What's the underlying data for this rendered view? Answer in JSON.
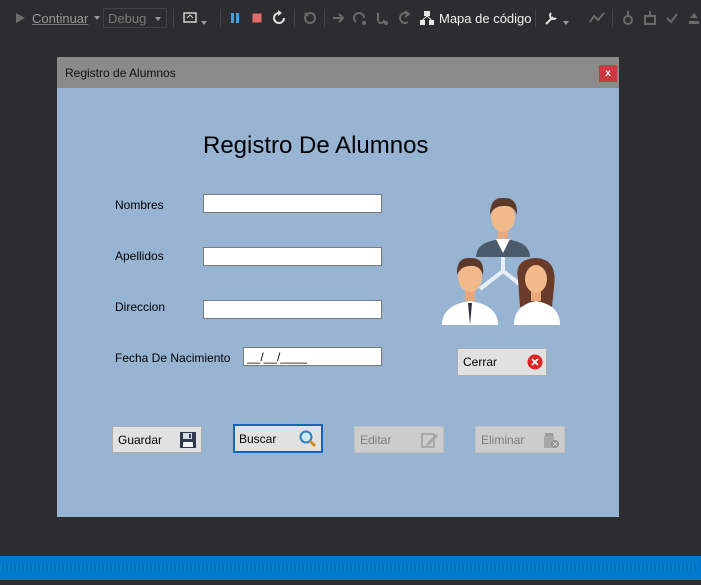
{
  "toolbar": {
    "continue_label": "Continuar",
    "config_select": "Debug",
    "codemap_label": "Mapa de código",
    "icons": [
      "play-icon",
      "process-icon",
      "pause-icon",
      "stop-icon",
      "restart-icon",
      "hot-reload-icon",
      "show-next-statement-icon",
      "step-into-icon",
      "step-over-icon",
      "step-out-icon",
      "code-map-icon",
      "tools-icon",
      "diagnostics-icon",
      "thread-icon",
      "stack-icon",
      "check-icon",
      "upload-icon"
    ]
  },
  "window": {
    "title": "Registro de Alumnos",
    "close_label": "x",
    "form_title": "Registro De Alumnos",
    "fields": {
      "nombres_label": "Nombres",
      "apellidos_label": "Apellidos",
      "direccion_label": "Direccion",
      "fecha_label": "Fecha De Nacimiento",
      "nombres_value": "",
      "apellidos_value": "",
      "direccion_value": "",
      "fecha_value": "__/__/____"
    },
    "buttons": {
      "cerrar": "Cerrar",
      "guardar": "Guardar",
      "buscar": "Buscar",
      "editar": "Editar",
      "eliminar": "Eliminar"
    }
  },
  "colors": {
    "form_bg": "#98b4d3",
    "titlebar": "#8a8a8a",
    "close_button": "#c9393d",
    "status_bar": "#007acc",
    "focus_border": "#1565c0"
  }
}
